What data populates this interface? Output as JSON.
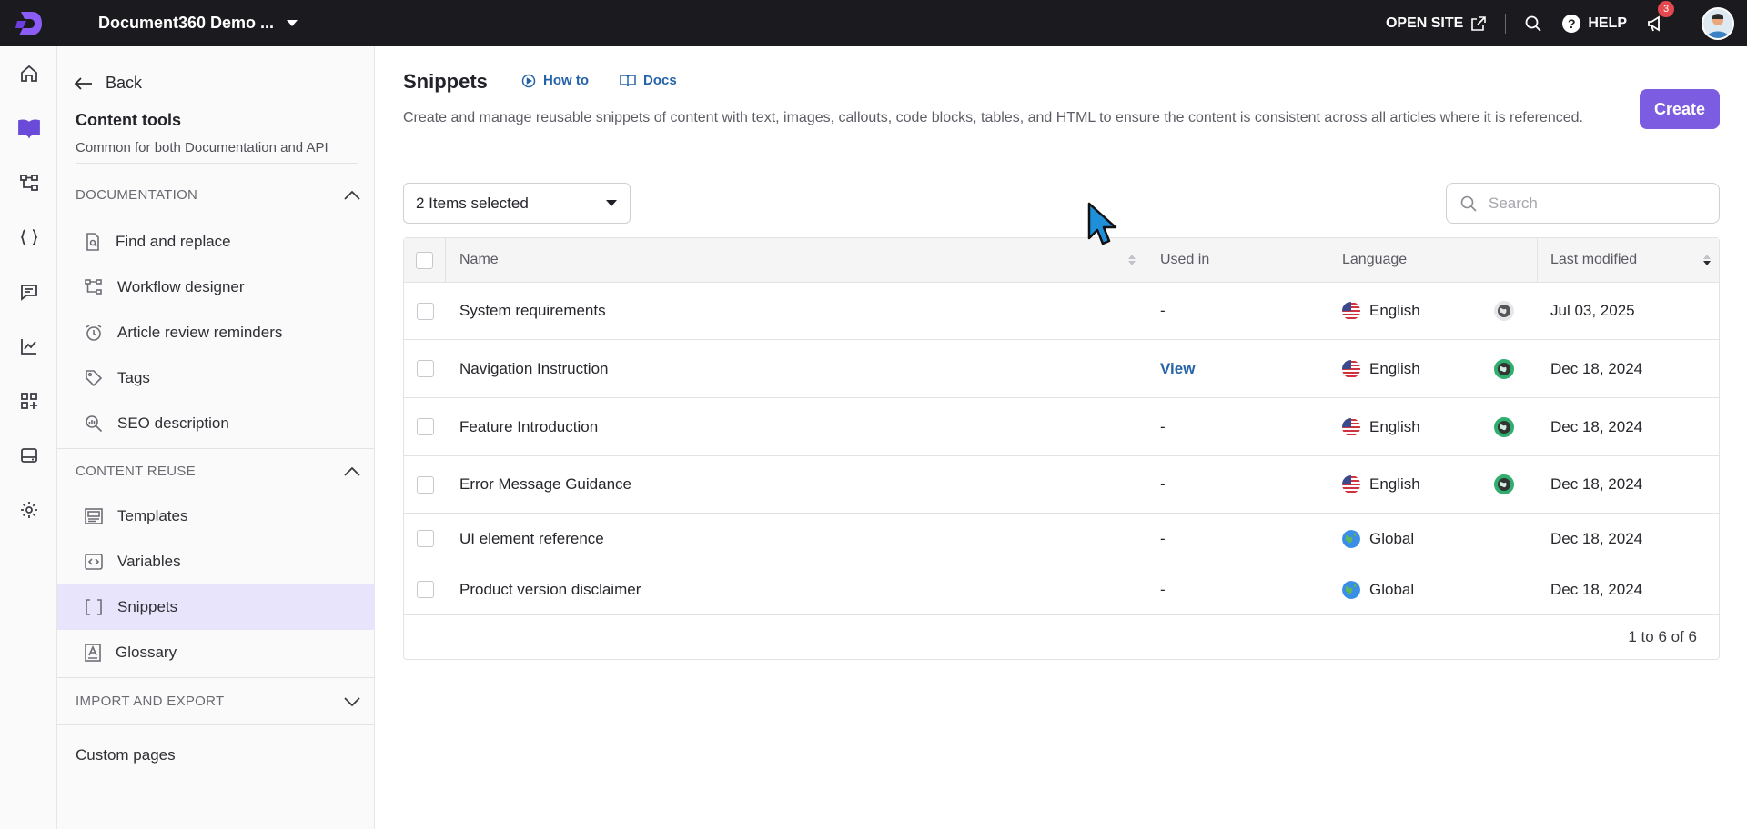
{
  "topbar": {
    "project_name": "Document360 Demo ...",
    "open_site_label": "OPEN SITE",
    "help_label": "HELP",
    "notifications_count": "3"
  },
  "sidebar": {
    "back_label": "Back",
    "title": "Content tools",
    "subtitle": "Common for both Documentation and API",
    "sections": [
      {
        "label": "DOCUMENTATION",
        "items": [
          {
            "label": "Find and replace"
          },
          {
            "label": "Workflow designer"
          },
          {
            "label": "Article review reminders"
          },
          {
            "label": "Tags"
          },
          {
            "label": "SEO description"
          }
        ]
      },
      {
        "label": "CONTENT REUSE",
        "items": [
          {
            "label": "Templates"
          },
          {
            "label": "Variables"
          },
          {
            "label": "Snippets",
            "active": true
          },
          {
            "label": "Glossary"
          }
        ]
      },
      {
        "label": "IMPORT AND EXPORT"
      }
    ],
    "custom_pages_label": "Custom pages"
  },
  "main": {
    "title": "Snippets",
    "how_to_label": "How to",
    "docs_label": "Docs",
    "description": "Create and manage reusable snippets of content with text, images, callouts, code blocks, tables, and HTML to ensure the content is consistent across all articles where it is referenced.",
    "create_label": "Create",
    "filter_value": "2 Items selected",
    "search_placeholder": "Search",
    "columns": {
      "name": "Name",
      "used_in": "Used in",
      "language": "Language",
      "last_modified": "Last modified"
    },
    "rows": [
      {
        "name": "System requirements",
        "used_in": "-",
        "language": "English",
        "modified": "Jul 03, 2025"
      },
      {
        "name": "Navigation Instruction",
        "used_in": "View",
        "language": "English",
        "modified": "Dec 18, 2024"
      },
      {
        "name": "Feature Introduction",
        "used_in": "-",
        "language": "English",
        "modified": "Dec 18, 2024"
      },
      {
        "name": "Error Message Guidance",
        "used_in": "-",
        "language": "English",
        "modified": "Dec 18, 2024"
      },
      {
        "name": "UI element reference",
        "used_in": "-",
        "language": "Global",
        "modified": "Dec 18, 2024"
      },
      {
        "name": "Product version disclaimer",
        "used_in": "-",
        "language": "Global",
        "modified": "Dec 18, 2024"
      }
    ],
    "pagination": "1 to 6 of 6"
  },
  "colors": {
    "accent": "#7c5ce0",
    "link": "#2563a8",
    "topbar": "#1b1b1f",
    "active_nav": "#e8e4fb"
  }
}
